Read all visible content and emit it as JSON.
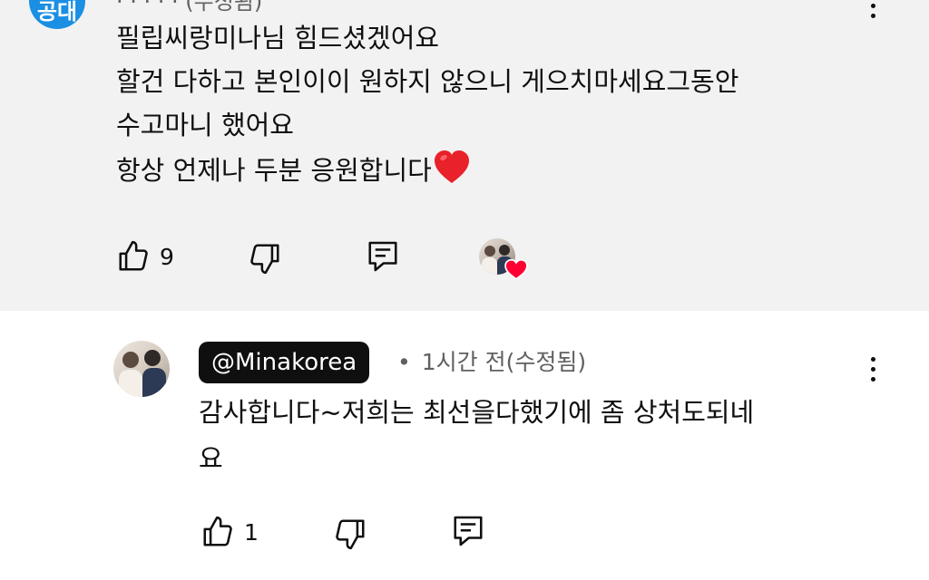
{
  "comment": {
    "avatar_text": "공대",
    "header_partial": "· · · · · (수정됨)",
    "lines": [
      "필립씨랑미나님 힘드셨겠어요",
      "할건 다하고 본인이이 원하지 않으니 게으치마세요그동안",
      "수고마니 했어요",
      "항상 언제나 두분 응원합니다"
    ],
    "emoji": "heart",
    "like_count": "9",
    "creator_heart": true,
    "colors": {
      "background": "#f2f2f2",
      "avatar": "#1a8fe3",
      "heart": "#ff0033"
    }
  },
  "reply": {
    "author": "@Minakorea",
    "separator": "•",
    "timestamp": "1시간 전(수정됨)",
    "lines": [
      "감사합니다~저희는 최선을다했기에 좀 상처도되네",
      "요"
    ],
    "like_count": "1",
    "colors": {
      "author_badge_bg": "#0f0f0f",
      "author_badge_text": "#ffffff",
      "meta_text": "#606060"
    }
  },
  "icons": {
    "like": "thumbs-up-icon",
    "dislike": "thumbs-down-icon",
    "reply": "comment-reply-icon",
    "more": "more-vertical-icon",
    "heart": "creator-heart-icon"
  }
}
